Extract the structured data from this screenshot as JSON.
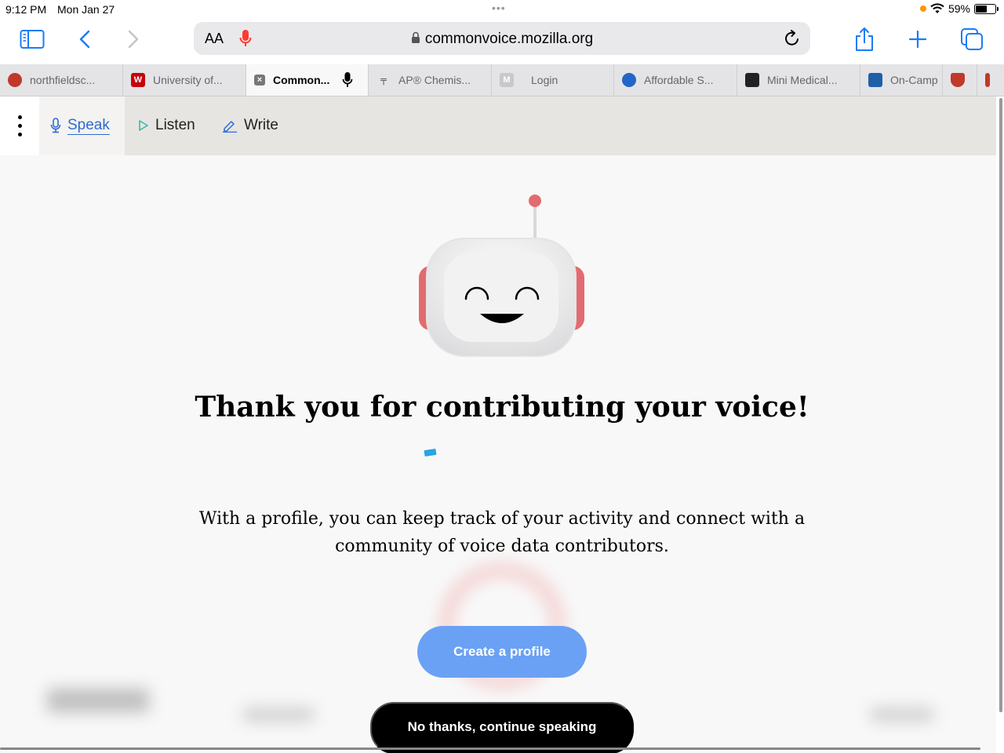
{
  "status_bar": {
    "time": "9:12 PM",
    "date": "Mon Jan 27",
    "battery": "59%",
    "battery_level": 0.59
  },
  "toolbar": {
    "text_size_label": "AA",
    "url": "commonvoice.mozilla.org"
  },
  "tabs": [
    {
      "label": "northfieldsc...",
      "icon": "northfield-favicon",
      "color": "#c0392b",
      "active": false
    },
    {
      "label": "University of...",
      "icon": "wisconsin-w-favicon",
      "color": "#c5050c",
      "active": false
    },
    {
      "label": "Common...",
      "icon": "close-icon",
      "color": "#777777",
      "active": true
    },
    {
      "label": "AP® Chemis...",
      "icon": "ap-favicon",
      "color": "#333333",
      "active": false
    },
    {
      "label": "Login",
      "icon": "m-favicon",
      "color": "#c8c8cc",
      "active": false
    },
    {
      "label": "Affordable S...",
      "icon": "affordable-favicon",
      "color": "#2466c7",
      "active": false
    },
    {
      "label": "Mini Medical...",
      "icon": "mini-medical-favicon",
      "color": "#222222",
      "active": false
    },
    {
      "label": "On-Camp",
      "icon": "on-campus-favicon",
      "color": "#1f5fa8",
      "active": false
    },
    {
      "label": "",
      "icon": "shield-favicon",
      "color": "#c0392b",
      "active": false
    },
    {
      "label": "",
      "icon": "red-favicon",
      "color": "#c0392b",
      "active": false
    }
  ],
  "nav": {
    "speak": "Speak",
    "listen": "Listen",
    "write": "Write"
  },
  "content": {
    "heading": "Thank you for contributing your voice!",
    "profile_text": "With a profile, you can keep track of your activity and connect with a community of voice data contributors.",
    "create_profile_button": "Create a profile",
    "no_thanks_button": "No thanks, continue speaking"
  },
  "colors": {
    "accent_blue": "#2e6bd2",
    "button_blue": "#6aa1f5",
    "listen_green": "#3fb8a6",
    "mic_red": "#ff3b30"
  }
}
